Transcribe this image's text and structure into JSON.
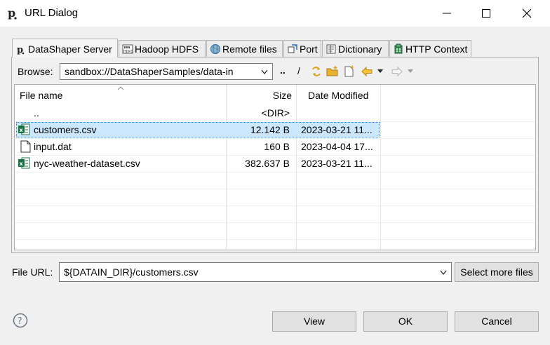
{
  "window": {
    "title": "URL Dialog"
  },
  "tabs": [
    {
      "label": "DataShaper Server",
      "icon": "datashaper-icon",
      "active": true
    },
    {
      "label": "Hadoop HDFS",
      "icon": "hdfs-icon"
    },
    {
      "label": "Remote files",
      "icon": "globe-icon"
    },
    {
      "label": "Port",
      "icon": "port-icon"
    },
    {
      "label": "Dictionary",
      "icon": "dictionary-icon"
    },
    {
      "label": "HTTP Context",
      "icon": "http-context-icon"
    }
  ],
  "browse": {
    "label": "Browse:",
    "path": "sandbox://DataShaperSamples/data-in",
    "parent_label": "..",
    "root_label": "/"
  },
  "table": {
    "columns": [
      "File name",
      "Size",
      "Date Modified"
    ],
    "rows": [
      {
        "name": "..",
        "size": "<DIR>",
        "date": "",
        "icon": ""
      },
      {
        "name": "customers.csv",
        "size": "12.142 B",
        "date": "2023-03-21 11...",
        "icon": "excel-icon",
        "selected": true
      },
      {
        "name": "input.dat",
        "size": "160 B",
        "date": "2023-04-04 17...",
        "icon": "file-icon"
      },
      {
        "name": "nyc-weather-dataset.csv",
        "size": "382.637 B",
        "date": "2023-03-21 11...",
        "icon": "excel-icon"
      }
    ]
  },
  "file_url": {
    "label": "File URL:",
    "value": "${DATAIN_DIR}/customers.csv",
    "select_more_label": "Select more files"
  },
  "buttons": {
    "view": "View",
    "ok": "OK",
    "cancel": "Cancel"
  },
  "colors": {
    "selection": "#cce8ff",
    "selection_border": "#3b7ddd",
    "excel_green": "#1d7044",
    "folder_yellow": "#e8b22c"
  }
}
